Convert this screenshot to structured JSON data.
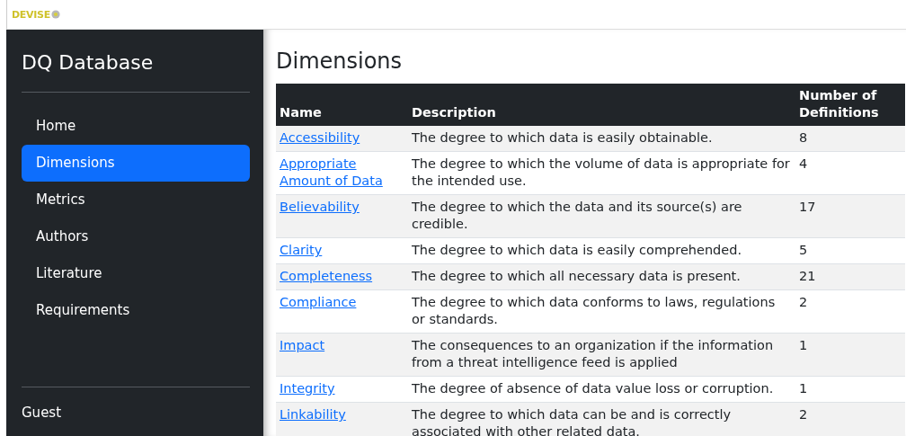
{
  "logo": {
    "text": "DEVISE"
  },
  "sidebar": {
    "title": "DQ Database",
    "items": [
      {
        "label": "Home",
        "selected": false
      },
      {
        "label": "Dimensions",
        "selected": true
      },
      {
        "label": "Metrics",
        "selected": false
      },
      {
        "label": "Authors",
        "selected": false
      },
      {
        "label": "Literature",
        "selected": false
      },
      {
        "label": "Requirements",
        "selected": false
      }
    ],
    "user": "Guest"
  },
  "page_title": "Dimensions",
  "table": {
    "columns": [
      "Name",
      "Description",
      "Number of Definitions"
    ],
    "rows": [
      [
        "Accessibility",
        "The degree to which data is easily obtainable.",
        "8"
      ],
      [
        "Appropriate Amount of Data",
        "The degree to which the volume of data is appropriate for the intended use.",
        "4"
      ],
      [
        "Believability",
        "The degree to which the data and its source(s) are credible.",
        "17"
      ],
      [
        "Clarity",
        "The degree to which data is easily comprehended.",
        "5"
      ],
      [
        "Completeness",
        "The degree to which all necessary data is present.",
        "21"
      ],
      [
        "Compliance",
        "The degree to which data conforms to laws, regulations or standards.",
        "2"
      ],
      [
        "Impact",
        "The consequences to an organization if the information from a threat intelligence feed is applied",
        "1"
      ],
      [
        "Integrity",
        "The degree of absence of data value loss or corruption.",
        "1"
      ],
      [
        "Linkability",
        "The degree to which data can be and is correctly associated with other related data.",
        "2"
      ]
    ]
  }
}
